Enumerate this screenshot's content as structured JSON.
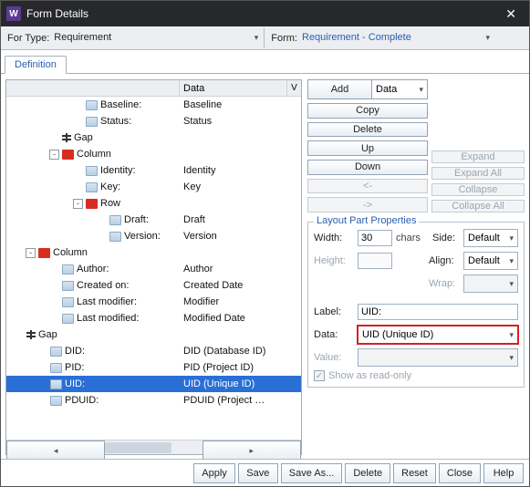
{
  "window": {
    "title": "Form Details"
  },
  "toolbar": {
    "for_type_label": "For Type:",
    "for_type_value": "Requirement",
    "form_label": "Form:",
    "form_value": "Requirement - Complete"
  },
  "tabs": {
    "definition": "Definition"
  },
  "tree": {
    "header": {
      "data": "Data",
      "v": "V"
    },
    "rows": [
      {
        "indent": 5,
        "toggle": "",
        "icon": "field",
        "label": "Baseline:",
        "data": "Baseline"
      },
      {
        "indent": 5,
        "toggle": "",
        "icon": "field",
        "label": "Status:",
        "data": "Status"
      },
      {
        "indent": 3,
        "toggle": "",
        "icon": "gap",
        "label": "Gap",
        "data": ""
      },
      {
        "indent": 3,
        "toggle": "-",
        "icon": "red",
        "label": "Column",
        "data": ""
      },
      {
        "indent": 5,
        "toggle": "",
        "icon": "field",
        "label": "Identity:",
        "data": "Identity"
      },
      {
        "indent": 5,
        "toggle": "",
        "icon": "field",
        "label": "Key:",
        "data": "Key"
      },
      {
        "indent": 5,
        "toggle": "-",
        "icon": "red",
        "label": "Row",
        "data": ""
      },
      {
        "indent": 7,
        "toggle": "",
        "icon": "field",
        "label": "Draft:",
        "data": "Draft"
      },
      {
        "indent": 7,
        "toggle": "",
        "icon": "field",
        "label": "Version:",
        "data": "Version"
      },
      {
        "indent": 1,
        "toggle": "-",
        "icon": "red",
        "label": "Column",
        "data": ""
      },
      {
        "indent": 3,
        "toggle": "",
        "icon": "field",
        "label": "Author:",
        "data": "Author"
      },
      {
        "indent": 3,
        "toggle": "",
        "icon": "field",
        "label": "Created on:",
        "data": "Created Date"
      },
      {
        "indent": 3,
        "toggle": "",
        "icon": "field",
        "label": "Last modifier:",
        "data": "Modifier"
      },
      {
        "indent": 3,
        "toggle": "",
        "icon": "field",
        "label": "Last modified:",
        "data": "Modified Date"
      },
      {
        "indent": 0,
        "toggle": "",
        "icon": "gap",
        "label": "Gap",
        "data": ""
      },
      {
        "indent": 2,
        "toggle": "",
        "icon": "field",
        "label": "DID:",
        "data": "DID (Database ID)"
      },
      {
        "indent": 2,
        "toggle": "",
        "icon": "field",
        "label": "PID:",
        "data": "PID (Project ID)"
      },
      {
        "indent": 2,
        "toggle": "",
        "icon": "field",
        "label": "UID:",
        "data": "UID (Unique ID)",
        "selected": true
      },
      {
        "indent": 2,
        "toggle": "",
        "icon": "field",
        "label": "PDUID:",
        "data": "PDUID (Project …"
      }
    ]
  },
  "buttons": {
    "add": "Add",
    "add_type": "Data",
    "copy": "Copy",
    "delete": "Delete",
    "up": "Up",
    "down": "Down",
    "left": "<-",
    "right": "->",
    "expand": "Expand",
    "expand_all": "Expand All",
    "collapse": "Collapse",
    "collapse_all": "Collapse All"
  },
  "props": {
    "group_title": "Layout Part Properties",
    "width_label": "Width:",
    "width_value": "30",
    "width_unit": "chars",
    "side_label": "Side:",
    "side_value": "Default",
    "height_label": "Height:",
    "height_value": "",
    "align_label": "Align:",
    "align_value": "Default",
    "wrap_label": "Wrap:",
    "wrap_value": "",
    "label_label": "Label:",
    "label_value": "UID:",
    "data_label": "Data:",
    "data_value": "UID (Unique ID)",
    "value_label": "Value:",
    "value_value": "",
    "readonly_label": "Show as read-only"
  },
  "footer": {
    "apply": "Apply",
    "save": "Save",
    "save_as": "Save As...",
    "delete": "Delete",
    "reset": "Reset",
    "close": "Close",
    "help": "Help"
  }
}
